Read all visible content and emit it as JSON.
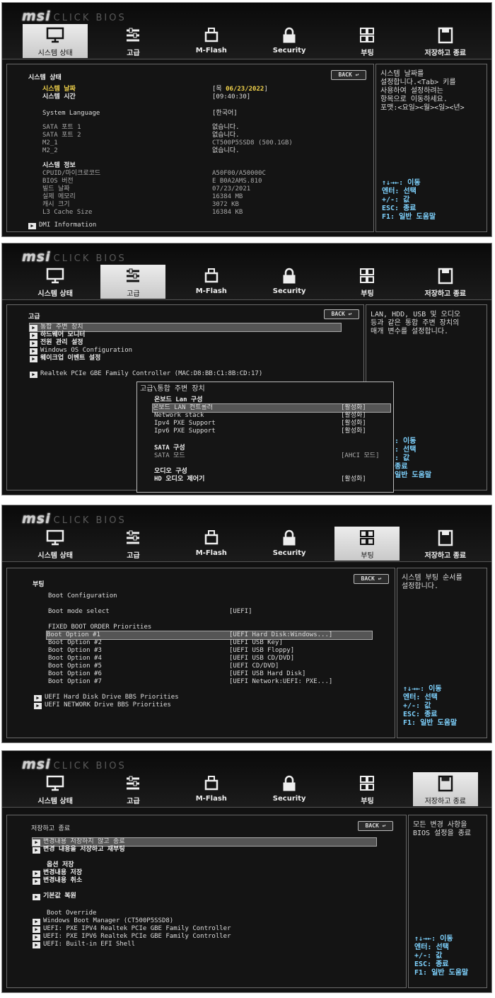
{
  "logo": {
    "brand": "msi",
    "product": "CLICK BIOS"
  },
  "tabs": [
    {
      "label": "시스템 상태",
      "icon": "monitor-icon"
    },
    {
      "label": "고급",
      "icon": "settings-sliders-icon"
    },
    {
      "label": "M-Flash",
      "icon": "usb-drive-icon"
    },
    {
      "label": "Security",
      "icon": "padlock-icon"
    },
    {
      "label": "부팅",
      "icon": "boot-icon"
    },
    {
      "label": "저장하고 종료",
      "icon": "floppy-disk-icon"
    }
  ],
  "back_label": "BACK ↩",
  "keys": [
    "↑↓→←: 이동",
    "엔터: 선택",
    "+/-: 값",
    "ESC: 종료",
    "F1: 일반 도움말"
  ],
  "screen1": {
    "heading": "시스템 상태",
    "date_label": "시스템 날짜",
    "date_value_prefix": "[목 ",
    "date_value_hl": "06/23/2022",
    "date_value_suffix": "]",
    "time_label": "시스템 시간",
    "time_value": "[09:40:30]",
    "lang_label": "System Language",
    "lang_value": "[한국어]",
    "storage": [
      {
        "label": "SATA 포트 1",
        "value": "없습니다."
      },
      {
        "label": "SATA 포트 2",
        "value": "없습니다."
      },
      {
        "label": "M2_1",
        "value": "CT500P5SSD8 (500.1GB)"
      },
      {
        "label": "M2_2",
        "value": "없습니다."
      }
    ],
    "info_heading": "시스템 정보",
    "info": [
      {
        "label": "CPUID/마이크로코드",
        "value": "A50F00/A50000C"
      },
      {
        "label": "BIOS 버전",
        "value": "E B0A2AMS.810"
      },
      {
        "label": "빌드 날짜",
        "value": "07/23/2021"
      },
      {
        "label": "실제 메모리",
        "value": "16384 MB"
      },
      {
        "label": "캐시 크기",
        "value": "3072 KB"
      },
      {
        "label": "L3 Cache Size",
        "value": "16384 KB"
      }
    ],
    "dmi": "DMI Information",
    "help": [
      "시스템 날짜를",
      "설정합니다.<Tab> 키를",
      "사용하여 설정하려는",
      "항목으로 이동하세요.",
      "포맷:<요일><월><일><년>"
    ]
  },
  "screen2": {
    "heading": "고급",
    "items": [
      "통합 주변 장치",
      "하드웨어 모니터",
      "전원 관리 설정",
      "Windows OS Configuration",
      "웨이크업 이벤트 설정"
    ],
    "lan": "Realtek PCIe GBE Family Controller (MAC:D8:BB:C1:8B:CD:17)",
    "help": [
      "LAN, HDD, USB 및 오디오",
      "등과 같은 통합 주변 장치의",
      "매개 변수를 설정합니다."
    ],
    "popup_title": "고급\\통합 주변 장치",
    "popup": {
      "lan_heading": "온보드 Lan 구성",
      "rows": [
        {
          "label": "온보드 LAN 컨트롤러",
          "value": "[활성화]"
        },
        {
          "label": "Network stack",
          "value": "[활성화]"
        },
        {
          "label": "Ipv4 PXE Support",
          "value": "[활성화]"
        },
        {
          "label": "Ipv6 PXE Support",
          "value": "[활성화]"
        }
      ],
      "sata_heading": "SATA 구성",
      "sata_label": "SATA 모드",
      "sata_value": "[AHCI 모드]",
      "audio_heading": "오디오 구성",
      "audio_label": "HD 오디오 제어기",
      "audio_value": "[활성화]"
    },
    "keys_partial": [
      ": 이동",
      ": 선택",
      ": 값",
      "종료",
      "일반 도움말"
    ]
  },
  "screen3": {
    "heading": "부팅",
    "boot_config": "Boot Configuration",
    "mode_label": "Boot mode select",
    "mode_value": "[UEFI]",
    "fixed": "FIXED BOOT ORDER Priorities",
    "options": [
      {
        "label": "Boot Option #1",
        "value": "[UEFI Hard Disk:Windows...]"
      },
      {
        "label": "Boot Option #2",
        "value": "[UEFI USB Key]"
      },
      {
        "label": "Boot Option #3",
        "value": "[UEFI USB Floppy]"
      },
      {
        "label": "Boot Option #4",
        "value": "[UEFI USB CD/DVD]"
      },
      {
        "label": "Boot Option #5",
        "value": "[UEFI CD/DVD]"
      },
      {
        "label": "Boot Option #6",
        "value": "[UEFI USB Hard Disk]"
      },
      {
        "label": "Boot Option #7",
        "value": "[UEFI Network:UEFI: PXE...]"
      }
    ],
    "bbs": [
      "UEFI Hard Disk Drive BBS Priorities",
      "UEFI NETWORK Drive BBS Priorities"
    ],
    "help": [
      "시스템 부팅 순서를",
      "설정합니다."
    ]
  },
  "screen4": {
    "heading": "저장하고 종료",
    "items": [
      "변경내용 저장하지 않고 종료",
      "변경 내용을 저장하고 재부팅"
    ],
    "opt_heading": "옵션 저장",
    "opt_items": [
      "변경내용 저장",
      "변경내용 취소"
    ],
    "default": "기본값 복원",
    "override_heading": "Boot Override",
    "override": [
      "Windows Boot Manager (CT500P5SSD8)",
      "UEFI: PXE IPV4 Realtek PCIe GBE Family Controller",
      "UEFI: PXE IPV6 Realtek PCIe GBE Family Controller",
      "UEFI: Built-in EFI Shell"
    ],
    "help": [
      "모든 변경 사항을",
      "BIOS 설정을 종료"
    ]
  }
}
